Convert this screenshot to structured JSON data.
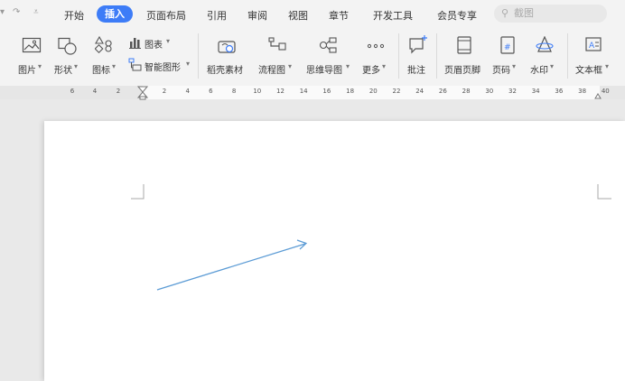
{
  "quick_access": [
    {
      "name": "dropdown-arrow-icon",
      "glyph": "▾"
    },
    {
      "name": "redo-icon",
      "glyph": "↷"
    },
    {
      "name": "customize-quick-access-icon",
      "glyph": "⩡"
    }
  ],
  "menu": [
    "开始",
    "插入",
    "页面布局",
    "引用",
    "审阅",
    "视图",
    "章节",
    "开发工具",
    "会员专享"
  ],
  "active_menu": "插入",
  "search": {
    "icon": "search-icon",
    "placeholder": "截图"
  },
  "ribbon": {
    "picture": "图片",
    "shapes": "形状",
    "icons": "图标",
    "chart": "图表",
    "smartart": "智能图形",
    "material": "稻壳素材",
    "flowchart": "流程图",
    "mindmap": "思维导图",
    "more": "更多",
    "comment": "批注",
    "header_footer": "页眉页脚",
    "page_number": "页码",
    "watermark": "水印",
    "textbox": "文本框",
    "dropdown_glyph": "▾"
  },
  "ruler": {
    "left_ticks": [
      "6",
      "4",
      "2"
    ],
    "right_ticks": [
      "2",
      "4",
      "6",
      "8",
      "10",
      "12",
      "14",
      "16",
      "18",
      "20",
      "22",
      "24",
      "26",
      "28",
      "30",
      "32",
      "34",
      "36",
      "38",
      "40",
      "4"
    ]
  },
  "colors": {
    "accent": "#3d7cf7",
    "arrow": "#5b9bd5",
    "page": "#ffffff",
    "canvas": "#e9e9e9"
  }
}
